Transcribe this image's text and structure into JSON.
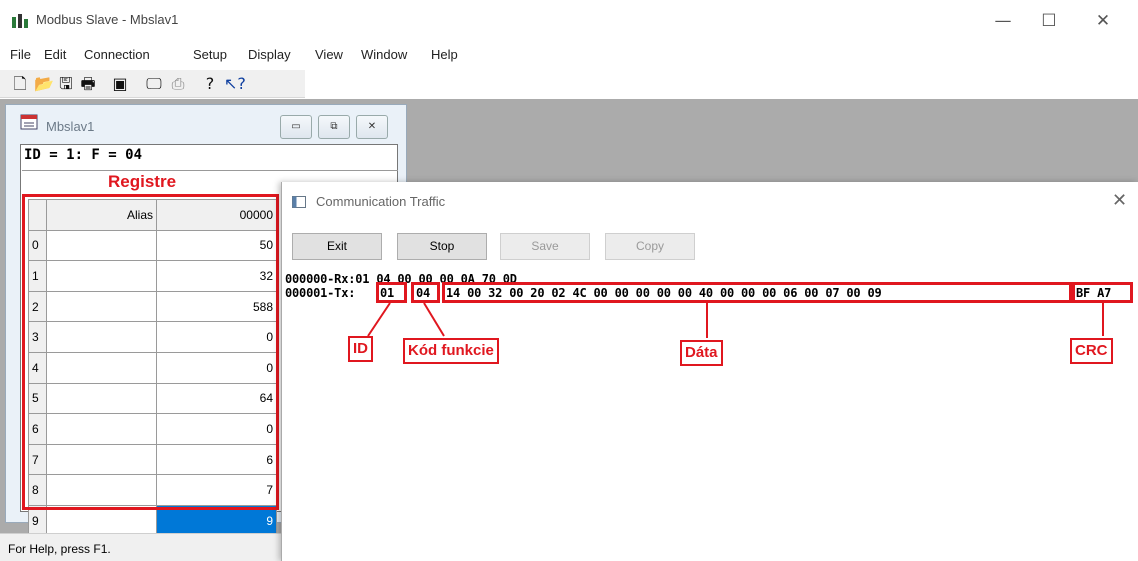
{
  "app": {
    "title": "Modbus Slave - Mbslav1",
    "window_controls": {
      "minimize": "—",
      "maximize": "☐",
      "close": "✕"
    },
    "icon": "modbus-app-icon"
  },
  "menu": [
    "File",
    "Edit",
    "Connection",
    "Setup",
    "Display",
    "View",
    "Window",
    "Help"
  ],
  "toolbar": {
    "icons": [
      "new-document-icon",
      "open-folder-icon",
      "save-disk-icon",
      "print-icon",
      "window-icon",
      "monitor-icon",
      "print-preview-icon",
      "help-icon",
      "context-help-icon"
    ]
  },
  "child_window": {
    "title": "Mbslav1",
    "controls": {
      "minimize": "▭",
      "restore": "⧉",
      "close": "✕"
    },
    "header": "ID = 1: F = 04",
    "columns": {
      "alias": "Alias",
      "address": "00000"
    },
    "rows": [
      {
        "n": "0",
        "value": "50"
      },
      {
        "n": "1",
        "value": "32"
      },
      {
        "n": "2",
        "value": "588"
      },
      {
        "n": "3",
        "value": "0"
      },
      {
        "n": "4",
        "value": "0"
      },
      {
        "n": "5",
        "value": "64"
      },
      {
        "n": "6",
        "value": "0"
      },
      {
        "n": "7",
        "value": "6"
      },
      {
        "n": "8",
        "value": "7"
      },
      {
        "n": "9",
        "value": "9"
      }
    ],
    "selected_row": "9"
  },
  "traffic": {
    "title": "Communication Traffic",
    "close": "✕",
    "buttons": {
      "exit": "Exit",
      "stop": "Stop",
      "save": "Save",
      "copy": "Copy"
    },
    "line_rx": "000000-Rx:01 04 00 00 00 0A 70 0D",
    "tx_prefix": "000001-Tx:",
    "tx_id": "01",
    "tx_func": "04",
    "tx_data": "14 00 32 00 20 02 4C 00 00 00 00 00 40 00 00 00 06 00 07 00 09",
    "tx_crc": "BF A7"
  },
  "annotations": {
    "registre": "Registre",
    "id": "ID",
    "function": "Kód funkcie",
    "data": "Dáta",
    "crc": "CRC",
    "color": "#e0171f"
  },
  "status": "For Help, press F1.",
  "colors": {
    "selection": "#0078d7",
    "mdi_background": "#ababab"
  }
}
